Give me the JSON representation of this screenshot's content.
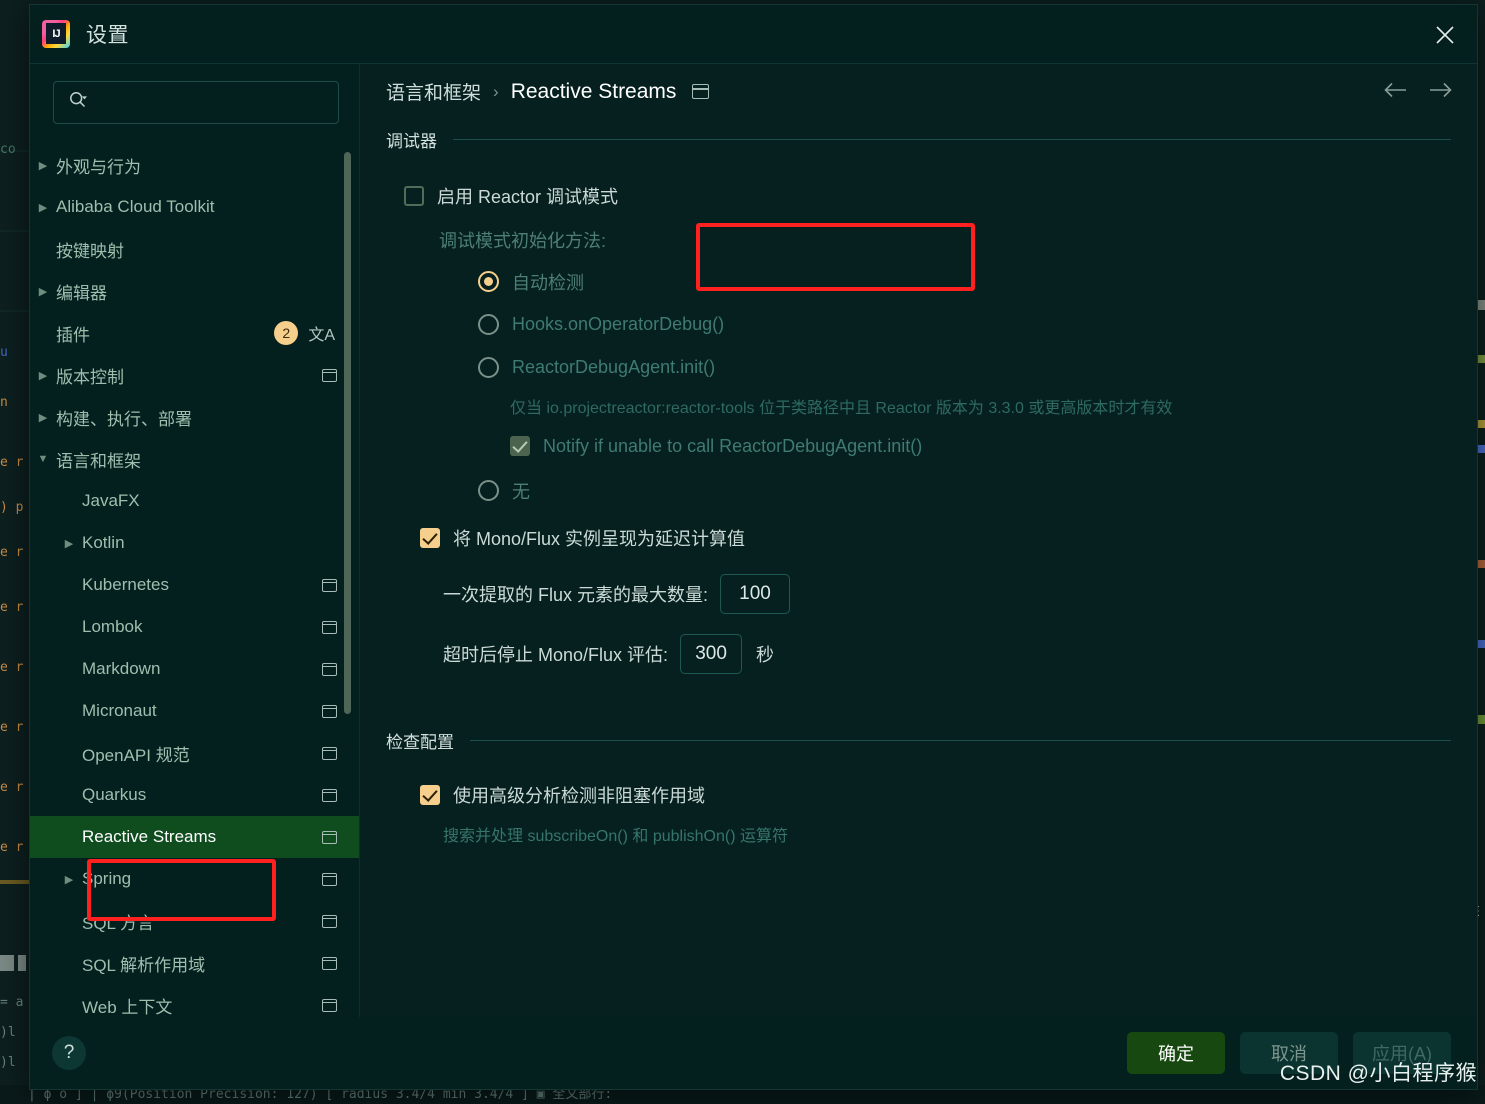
{
  "window": {
    "title": "设置",
    "logo_text": "IJ",
    "close_icon": "close-icon"
  },
  "search": {
    "value": "",
    "placeholder": "",
    "icon": "search-icon"
  },
  "sidebar": {
    "scrollbar": "vertical-scrollbar",
    "items": [
      {
        "label": "外观与行为",
        "twisty": "▶",
        "indent": 0,
        "badge": "",
        "scope": false,
        "translate": false,
        "selected": false
      },
      {
        "label": "Alibaba Cloud Toolkit",
        "twisty": "▶",
        "indent": 0,
        "badge": "",
        "scope": false,
        "translate": false,
        "selected": false
      },
      {
        "label": "按键映射",
        "twisty": "",
        "indent": 0,
        "badge": "",
        "scope": false,
        "translate": false,
        "selected": false
      },
      {
        "label": "编辑器",
        "twisty": "▶",
        "indent": 0,
        "badge": "",
        "scope": false,
        "translate": false,
        "selected": false
      },
      {
        "label": "插件",
        "twisty": "",
        "indent": 0,
        "badge": "2",
        "scope": false,
        "translate": true,
        "selected": false
      },
      {
        "label": "版本控制",
        "twisty": "▶",
        "indent": 0,
        "badge": "",
        "scope": true,
        "translate": false,
        "selected": false
      },
      {
        "label": "构建、执行、部署",
        "twisty": "▶",
        "indent": 0,
        "badge": "",
        "scope": false,
        "translate": false,
        "selected": false
      },
      {
        "label": "语言和框架",
        "twisty": "▼",
        "indent": 0,
        "badge": "",
        "scope": false,
        "translate": false,
        "selected": false
      },
      {
        "label": "JavaFX",
        "twisty": "",
        "indent": 1,
        "badge": "",
        "scope": false,
        "translate": false,
        "selected": false
      },
      {
        "label": "Kotlin",
        "twisty": "▶",
        "indent": 1,
        "badge": "",
        "scope": false,
        "translate": false,
        "selected": false
      },
      {
        "label": "Kubernetes",
        "twisty": "",
        "indent": 1,
        "badge": "",
        "scope": true,
        "translate": false,
        "selected": false
      },
      {
        "label": "Lombok",
        "twisty": "",
        "indent": 1,
        "badge": "",
        "scope": true,
        "translate": false,
        "selected": false
      },
      {
        "label": "Markdown",
        "twisty": "",
        "indent": 1,
        "badge": "",
        "scope": true,
        "translate": false,
        "selected": false
      },
      {
        "label": "Micronaut",
        "twisty": "",
        "indent": 1,
        "badge": "",
        "scope": true,
        "translate": false,
        "selected": false
      },
      {
        "label": "OpenAPI 规范",
        "twisty": "",
        "indent": 1,
        "badge": "",
        "scope": true,
        "translate": false,
        "selected": false
      },
      {
        "label": "Quarkus",
        "twisty": "",
        "indent": 1,
        "badge": "",
        "scope": true,
        "translate": false,
        "selected": false
      },
      {
        "label": "Reactive Streams",
        "twisty": "",
        "indent": 1,
        "badge": "",
        "scope": true,
        "translate": false,
        "selected": true
      },
      {
        "label": "Spring",
        "twisty": "▶",
        "indent": 1,
        "badge": "",
        "scope": true,
        "translate": false,
        "selected": false
      },
      {
        "label": "SQL 方言",
        "twisty": "",
        "indent": 1,
        "badge": "",
        "scope": true,
        "translate": false,
        "selected": false
      },
      {
        "label": "SQL 解析作用域",
        "twisty": "",
        "indent": 1,
        "badge": "",
        "scope": true,
        "translate": false,
        "selected": false
      },
      {
        "label": "Web 上下文",
        "twisty": "",
        "indent": 1,
        "badge": "",
        "scope": true,
        "translate": false,
        "selected": false
      }
    ]
  },
  "breadcrumb": {
    "parent": "语言和框架",
    "separator": "›",
    "current": "Reactive Streams",
    "scope_icon": "project-scope-icon",
    "back_icon": "arrow-left-icon",
    "forward_icon": "arrow-right-icon"
  },
  "debugger_section": {
    "title": "调试器",
    "enable_reactor_debug": {
      "label": "启用 Reactor 调试模式",
      "checked": false
    },
    "init_method_label": "调试模式初始化方法:",
    "radios": [
      {
        "label": "自动检测",
        "selected": true
      },
      {
        "label": "Hooks.onOperatorDebug()",
        "selected": false
      },
      {
        "label": "ReactorDebugAgent.init()",
        "selected": false
      },
      {
        "label": "无",
        "selected": false
      }
    ],
    "agent_hint": "仅当 io.projectreactor:reactor-tools 位于类路径中且 Reactor 版本为 3.3.0 或更高版本时才有效",
    "notify_checkbox": {
      "label": "Notify if unable to call ReactorDebugAgent.init()",
      "checked": true
    },
    "render_lazy": {
      "label": "将 Mono/Flux 实例呈现为延迟计算值",
      "checked": true
    },
    "max_elements": {
      "label": "一次提取的 Flux 元素的最大数量:",
      "value": "100"
    },
    "timeout": {
      "label": "超时后停止 Mono/Flux 评估:",
      "value": "300",
      "unit": "秒"
    }
  },
  "inspection_section": {
    "title": "检查配置",
    "advanced_analysis": {
      "label": "使用高级分析检测非阻塞作用域",
      "checked": true
    },
    "hint": "搜索并处理 subscribeOn() 和 publishOn() 运算符"
  },
  "footer": {
    "help_label": "?",
    "ok_label": "确定",
    "cancel_label": "取消",
    "apply_label": "应用(A)"
  },
  "watermark": "CSDN @小白程序猴",
  "backdrop": {
    "bottom_code": "|   ϕ    o    ]  | ϕ9(Position Precision: 127)   [  radius 3.4/4 min 3.4/4 ]  ▣ 全文部行:"
  },
  "colors": {
    "accent": "#f7cf8d",
    "selection": "#0f4d1f",
    "annotation": "#ff2020",
    "primary_button": "#17480f",
    "dialog_bg": "#05201f"
  }
}
